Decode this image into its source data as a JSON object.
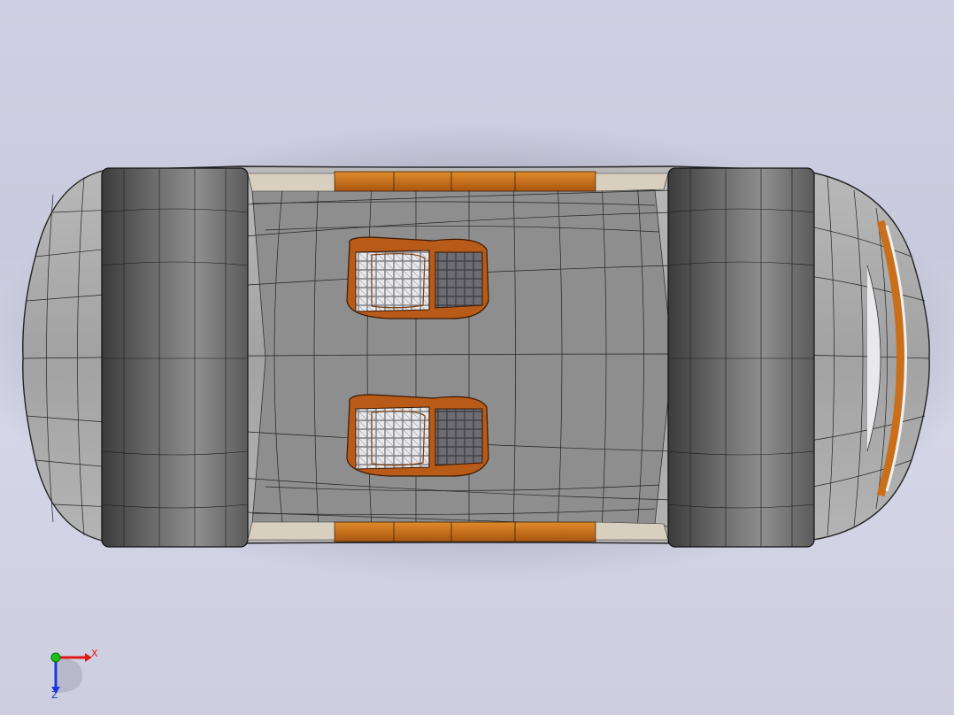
{
  "viewport": {
    "background_top": "#cfd0e3",
    "background_bottom": "#cdcee0"
  },
  "model": {
    "body_color": "#9a9a9a",
    "wheel_color": "#6f6f6f",
    "trim_color": "#c96f1c",
    "seat_frame_color": "#b85a18"
  },
  "triad": {
    "x_label": "X",
    "z_label": "Z",
    "x_color": "#e01818",
    "y_color": "#18c018",
    "z_color": "#1838e0"
  }
}
